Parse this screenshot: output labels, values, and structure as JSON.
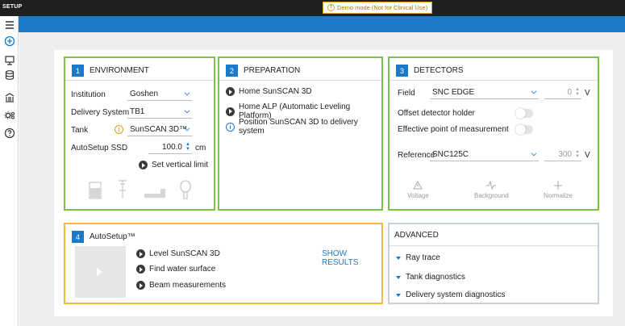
{
  "app": {
    "title": "SETUP",
    "banner": "Demo mode (Not for Clinical Use)"
  },
  "sidebar": {
    "items": [
      {
        "name": "menu-icon"
      },
      {
        "name": "add-scan-icon"
      },
      {
        "name": "analysis-icon"
      },
      {
        "name": "database-icon"
      },
      {
        "name": "institution-icon"
      },
      {
        "name": "settings-icon"
      },
      {
        "name": "help-icon"
      }
    ]
  },
  "environment": {
    "number": "1",
    "title": "ENVIRONMENT",
    "institution_label": "Institution",
    "institution_value": "Goshen",
    "delivery_label": "Delivery System",
    "delivery_value": "TB1",
    "tank_label": "Tank",
    "tank_value": "SunSCAN 3D™",
    "ssd_label": "AutoSetup SSD",
    "ssd_value": "100.0",
    "ssd_unit": "cm",
    "vertical_limit": "Set vertical limit"
  },
  "preparation": {
    "number": "2",
    "title": "PREPARATION",
    "items": [
      "Home SunSCAN 3D",
      "Home ALP (Automatic Leveling Platform)",
      "Position SunSCAN 3D to delivery system"
    ]
  },
  "detectors": {
    "number": "3",
    "title": "DETECTORS",
    "field_label": "Field",
    "field_value": "SNC EDGE",
    "field_voltage": "0",
    "field_unit": "V",
    "offset_label": "Offset detector holder",
    "offset_on": false,
    "effective_label": "Effective point of measurement",
    "effective_on": false,
    "reference_label": "Reference",
    "reference_value": "SNC125C",
    "reference_voltage": "300",
    "reference_unit": "V",
    "voltage_label": "Voltage",
    "background_label": "Background",
    "normalize_label": "Normalize"
  },
  "autosetup": {
    "number": "4",
    "title": "AutoSetup™",
    "show_results": "SHOW RESULTS",
    "steps": [
      "Level SunSCAN 3D",
      "Find water surface",
      "Beam measurements"
    ]
  },
  "advanced": {
    "title": "ADVANCED",
    "items": [
      "Ray trace",
      "Tank diagnostics",
      "Delivery system diagnostics"
    ]
  },
  "colors": {
    "accent": "#1a79c9",
    "green": "#7cc243",
    "orange": "#f5b93a",
    "topbar": "#1f1f1f"
  }
}
